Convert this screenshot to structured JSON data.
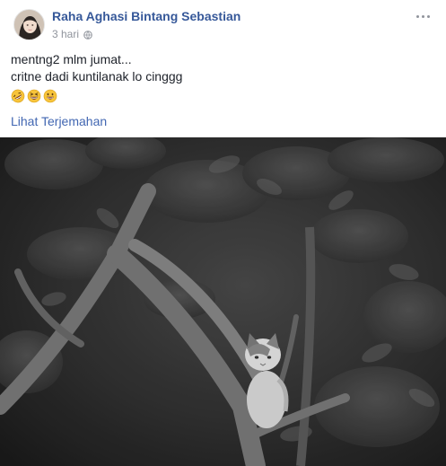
{
  "post": {
    "author_name": "Raha Aghasi Bintang Sebastian",
    "timestamp": "3 hari",
    "privacy_icon": "globe-icon",
    "more_icon": "more-options-icon",
    "text_lines": [
      "mentng2 mlm jumat...",
      "critne dadi kuntilanak lo cinggg"
    ],
    "emojis": [
      "rolling-laughing-emoji",
      "grinning-squinting-emoji",
      "grinning-emoji"
    ],
    "translate_label": "Lihat Terjemahan"
  },
  "colors": {
    "author_link": "#365899",
    "text": "#1d2129",
    "meta": "#90949c",
    "translate_link": "#4267b2"
  }
}
